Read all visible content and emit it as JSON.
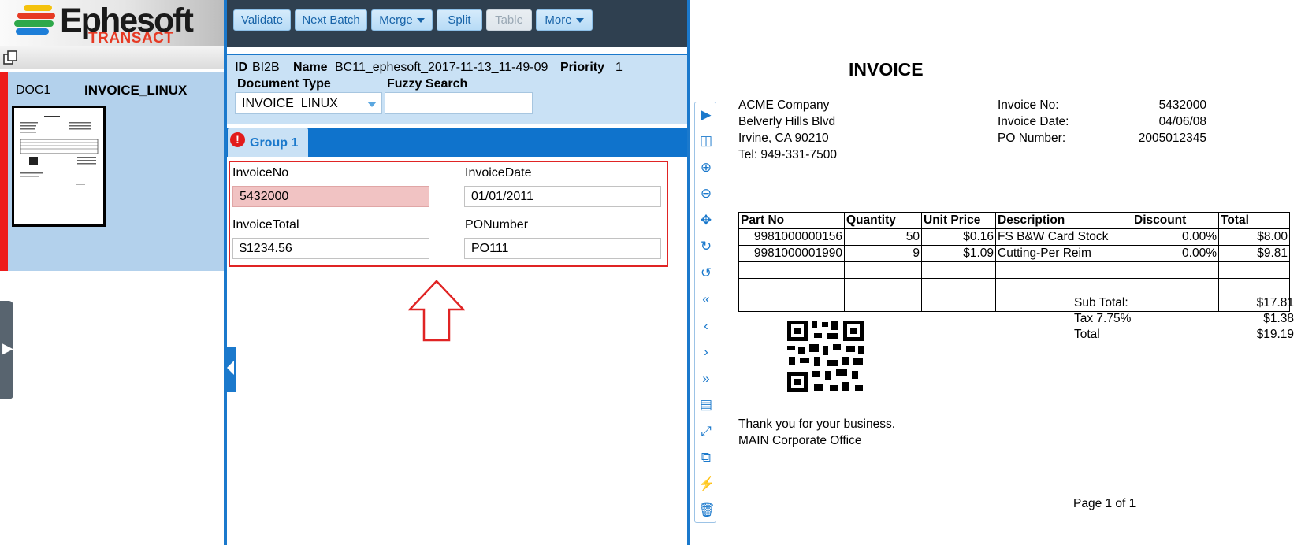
{
  "brand": {
    "name": "Ephesoft",
    "product": "TRANSACT"
  },
  "left_panel": {
    "doc_id": "DOC1",
    "doc_type": "INVOICE_LINUX"
  },
  "toolbar": {
    "buttons": [
      "Validate",
      "Next Batch",
      "Merge",
      "Split",
      "Table",
      "More"
    ]
  },
  "batch_info": {
    "id_label": "ID",
    "id_value": "BI2B",
    "name_label": "Name",
    "name_value": "BC11_ephesoft_2017-11-13_11-49-09",
    "priority_label": "Priority",
    "priority_value": "1",
    "doctype_label": "Document Type",
    "doctype_value": "INVOICE_LINUX",
    "fuzzy_label": "Fuzzy Search",
    "fuzzy_value": ""
  },
  "group": {
    "label": "Group 1",
    "alert": "!"
  },
  "fields": {
    "invoice_no_label": "InvoiceNo",
    "invoice_no_value": "5432000",
    "invoice_date_label": "InvoiceDate",
    "invoice_date_value": "01/01/2011",
    "invoice_total_label": "InvoiceTotal",
    "invoice_total_value": "$1234.56",
    "po_number_label": "PONumber",
    "po_number_value": "PO111"
  },
  "vertical_toolbar_icons": [
    "play-icon",
    "split-view-icon",
    "zoom-in-icon",
    "zoom-out-icon",
    "move-icon",
    "rotate-cw-icon",
    "rotate-ccw-icon",
    "first-page-icon",
    "prev-page-icon",
    "next-page-icon",
    "last-page-icon",
    "document-icon",
    "fit-icon",
    "copy-icon",
    "plug-icon",
    "trash-icon"
  ],
  "invoice": {
    "title": "INVOICE",
    "company": [
      "ACME Company",
      "Belverly Hills Blvd",
      "Irvine, CA 90210",
      "Tel: 949-331-7500"
    ],
    "meta_labels": [
      "Invoice No:",
      "Invoice Date:",
      "PO Number:"
    ],
    "meta_values": [
      "5432000",
      "04/06/08",
      "2005012345"
    ],
    "table_headers": [
      "Part No",
      "Quantity",
      "Unit Price",
      "Description",
      "Discount",
      "Total"
    ],
    "rows": [
      [
        "9981000000156",
        "50",
        "$0.16",
        "FS B&W Card Stock",
        "0.00%",
        "$8.00"
      ],
      [
        "9981000001990",
        "9",
        "$1.09",
        "Cutting-Per Reim",
        "0.00%",
        "$9.81"
      ]
    ],
    "totals_labels": [
      "Sub Total:",
      "Tax 7.75%",
      "Total"
    ],
    "totals_values": [
      "$17.81",
      "$1.38",
      "$19.19"
    ],
    "footer": [
      "Thank you for your business.",
      "MAIN Corporate Office"
    ],
    "page": "Page 1 of 1"
  },
  "colors": {
    "accent": "#1b79cc",
    "error_field": "#f1c3c3",
    "highlight_box": "#e02424",
    "doc_alert": "#ee1c1c"
  }
}
